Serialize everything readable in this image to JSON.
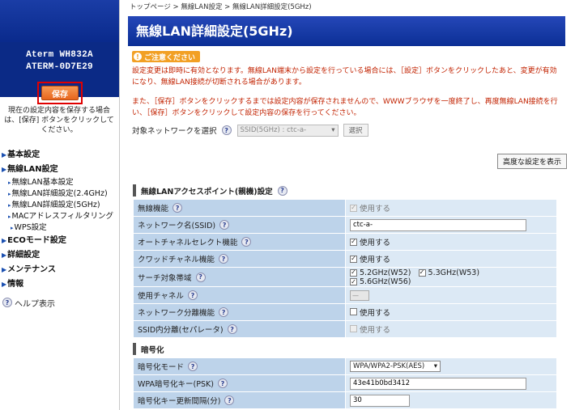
{
  "sidebar": {
    "device_line1": "Aterm  WH832A",
    "device_line2": "ATERM-0D7E29",
    "save_label": "保存",
    "save_note": "現在の設定内容を保存する場合は、[保存] ボタンをクリックしてください。",
    "menu": {
      "basic": "基本設定",
      "wlan": "無線LAN設定",
      "wlan_basic": "無線LAN基本設定",
      "wlan_24": "無線LAN詳細設定(2.4GHz)",
      "wlan_5": "無線LAN詳細設定(5GHz)",
      "mac_filter": "MACアドレスフィルタリング",
      "wps": "WPS設定",
      "eco": "ECOモード設定",
      "detail": "詳細設定",
      "maintenance": "メンテナンス",
      "info": "情報",
      "help": "ヘルプ表示"
    }
  },
  "main": {
    "breadcrumb": "トップページ > 無線LAN設定 > 無線LAN詳細設定(5GHz)",
    "title": "無線LAN詳細設定(5GHz)",
    "caution_label": "ご注意ください",
    "warn1": "設定変更は即時に有効となります。無線LAN端末から設定を行っている場合には、［設定］ボタンをクリックしたあと、変更が有効になり、無線LAN接続が切断される場合があります。",
    "warn2": "また、［保存］ボタンをクリックするまでは設定内容が保存されませんので、WWWブラウザを一度終了し、再度無線LAN接続を行い、［保存］ボタンをクリックして設定内容の保存を行ってください。",
    "target_label": "対象ネットワークを選択",
    "target_value": "SSID(5GHz) : ctc-a-",
    "select_button": "選択",
    "advanced_button": "高度な設定を表示",
    "section1_title": "無線LANアクセスポイント(親機)設定",
    "section2_title": "暗号化",
    "use_label": "使用する",
    "rows1": {
      "wireless": "無線機能",
      "ssid": "ネットワーク名(SSID)",
      "ssid_value": "ctc-a-",
      "auto_channel": "オートチャネルセレクト機能",
      "crowd_channel": "クワッドチャネル機能",
      "search_band": "サーチ対象帯域",
      "band_w52": "5.2GHz(W52)",
      "band_w53": "5.3GHz(W53)",
      "band_w56": "5.6GHz(W56)",
      "channel": "使用チャネル",
      "channel_value": "—",
      "separator": "ネットワーク分離機能",
      "ssid_separator": "SSID内分離(セパレータ)"
    },
    "rows2": {
      "enc_mode": "暗号化モード",
      "enc_mode_value": "WPA/WPA2-PSK(AES)",
      "psk": "WPA暗号化キー(PSK)",
      "psk_value": "43e41b0bd3412",
      "rekey": "暗号化キー更新間隔(分)",
      "rekey_value": "30"
    }
  }
}
